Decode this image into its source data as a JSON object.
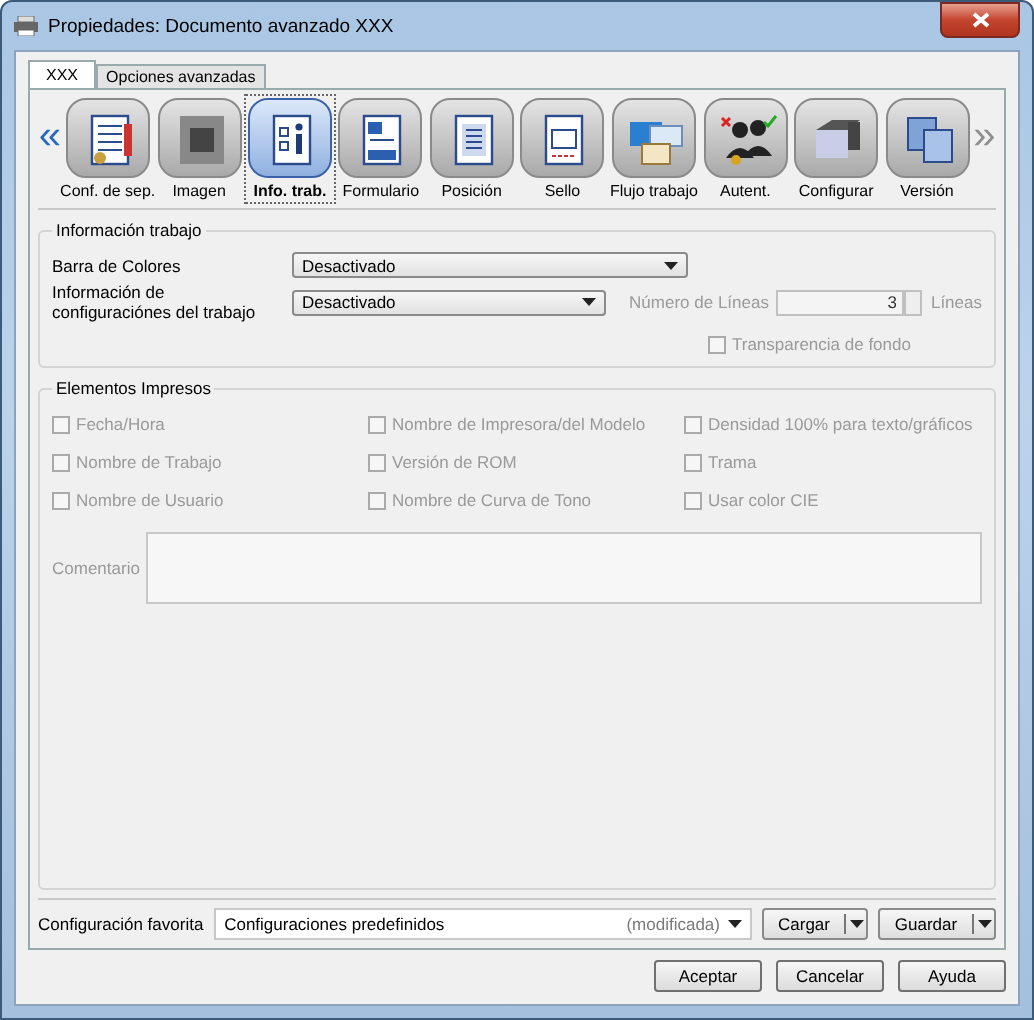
{
  "window": {
    "title": "Propiedades: Documento avanzado XXX"
  },
  "tabs": [
    {
      "label": "XXX",
      "selected": true
    },
    {
      "label": "Opciones avanzadas",
      "selected": false
    }
  ],
  "toolbar": {
    "prev": {
      "label": "«",
      "disabled": false
    },
    "next": {
      "label": "»",
      "disabled": true
    },
    "items": [
      {
        "label": "Conf. de sep.",
        "selected": false
      },
      {
        "label": "Imagen",
        "selected": false
      },
      {
        "label": "Info. trab.",
        "selected": true
      },
      {
        "label": "Formulario",
        "selected": false
      },
      {
        "label": "Posición",
        "selected": false
      },
      {
        "label": "Sello",
        "selected": false
      },
      {
        "label": "Flujo trabajo",
        "selected": false
      },
      {
        "label": "Autent.",
        "selected": false
      },
      {
        "label": "Configurar",
        "selected": false
      },
      {
        "label": "Versión",
        "selected": false
      }
    ]
  },
  "job_info": {
    "title": "Información trabajo",
    "color_bar": {
      "label": "Barra de Colores",
      "value": "Desactivado"
    },
    "settings_info": {
      "label": "Información de configuraciónes del trabajo",
      "value": "Desactivado"
    },
    "lines": {
      "label": "Número de Líneas",
      "value": "3",
      "unit": "Líneas",
      "disabled": true
    },
    "background_transparency": {
      "label": "Transparencia de fondo",
      "checked": false,
      "disabled": true
    }
  },
  "printed_items": {
    "title": "Elementos Impresos",
    "checkboxes": [
      {
        "label": "Fecha/Hora",
        "checked": false,
        "disabled": true
      },
      {
        "label": "Nombre de Impresora/del Modelo",
        "checked": false,
        "disabled": true
      },
      {
        "label": "Densidad 100% para texto/gráficos",
        "checked": false,
        "disabled": true
      },
      {
        "label": "Nombre de Trabajo",
        "checked": false,
        "disabled": true
      },
      {
        "label": "Versión de ROM",
        "checked": false,
        "disabled": true
      },
      {
        "label": "Trama",
        "checked": false,
        "disabled": true
      },
      {
        "label": "Nombre de Usuario",
        "checked": false,
        "disabled": true
      },
      {
        "label": "Nombre de Curva de Tono",
        "checked": false,
        "disabled": true
      },
      {
        "label": "Usar color CIE",
        "checked": false,
        "disabled": true
      }
    ],
    "comment": {
      "label": "Comentario",
      "disabled": true
    }
  },
  "favorite": {
    "label": "Configuración favorita",
    "value": "Configuraciones predefinidos",
    "note": "(modificada)",
    "load": "Cargar",
    "save": "Guardar"
  },
  "buttons": [
    "Aceptar",
    "Cancelar",
    "Ayuda"
  ]
}
